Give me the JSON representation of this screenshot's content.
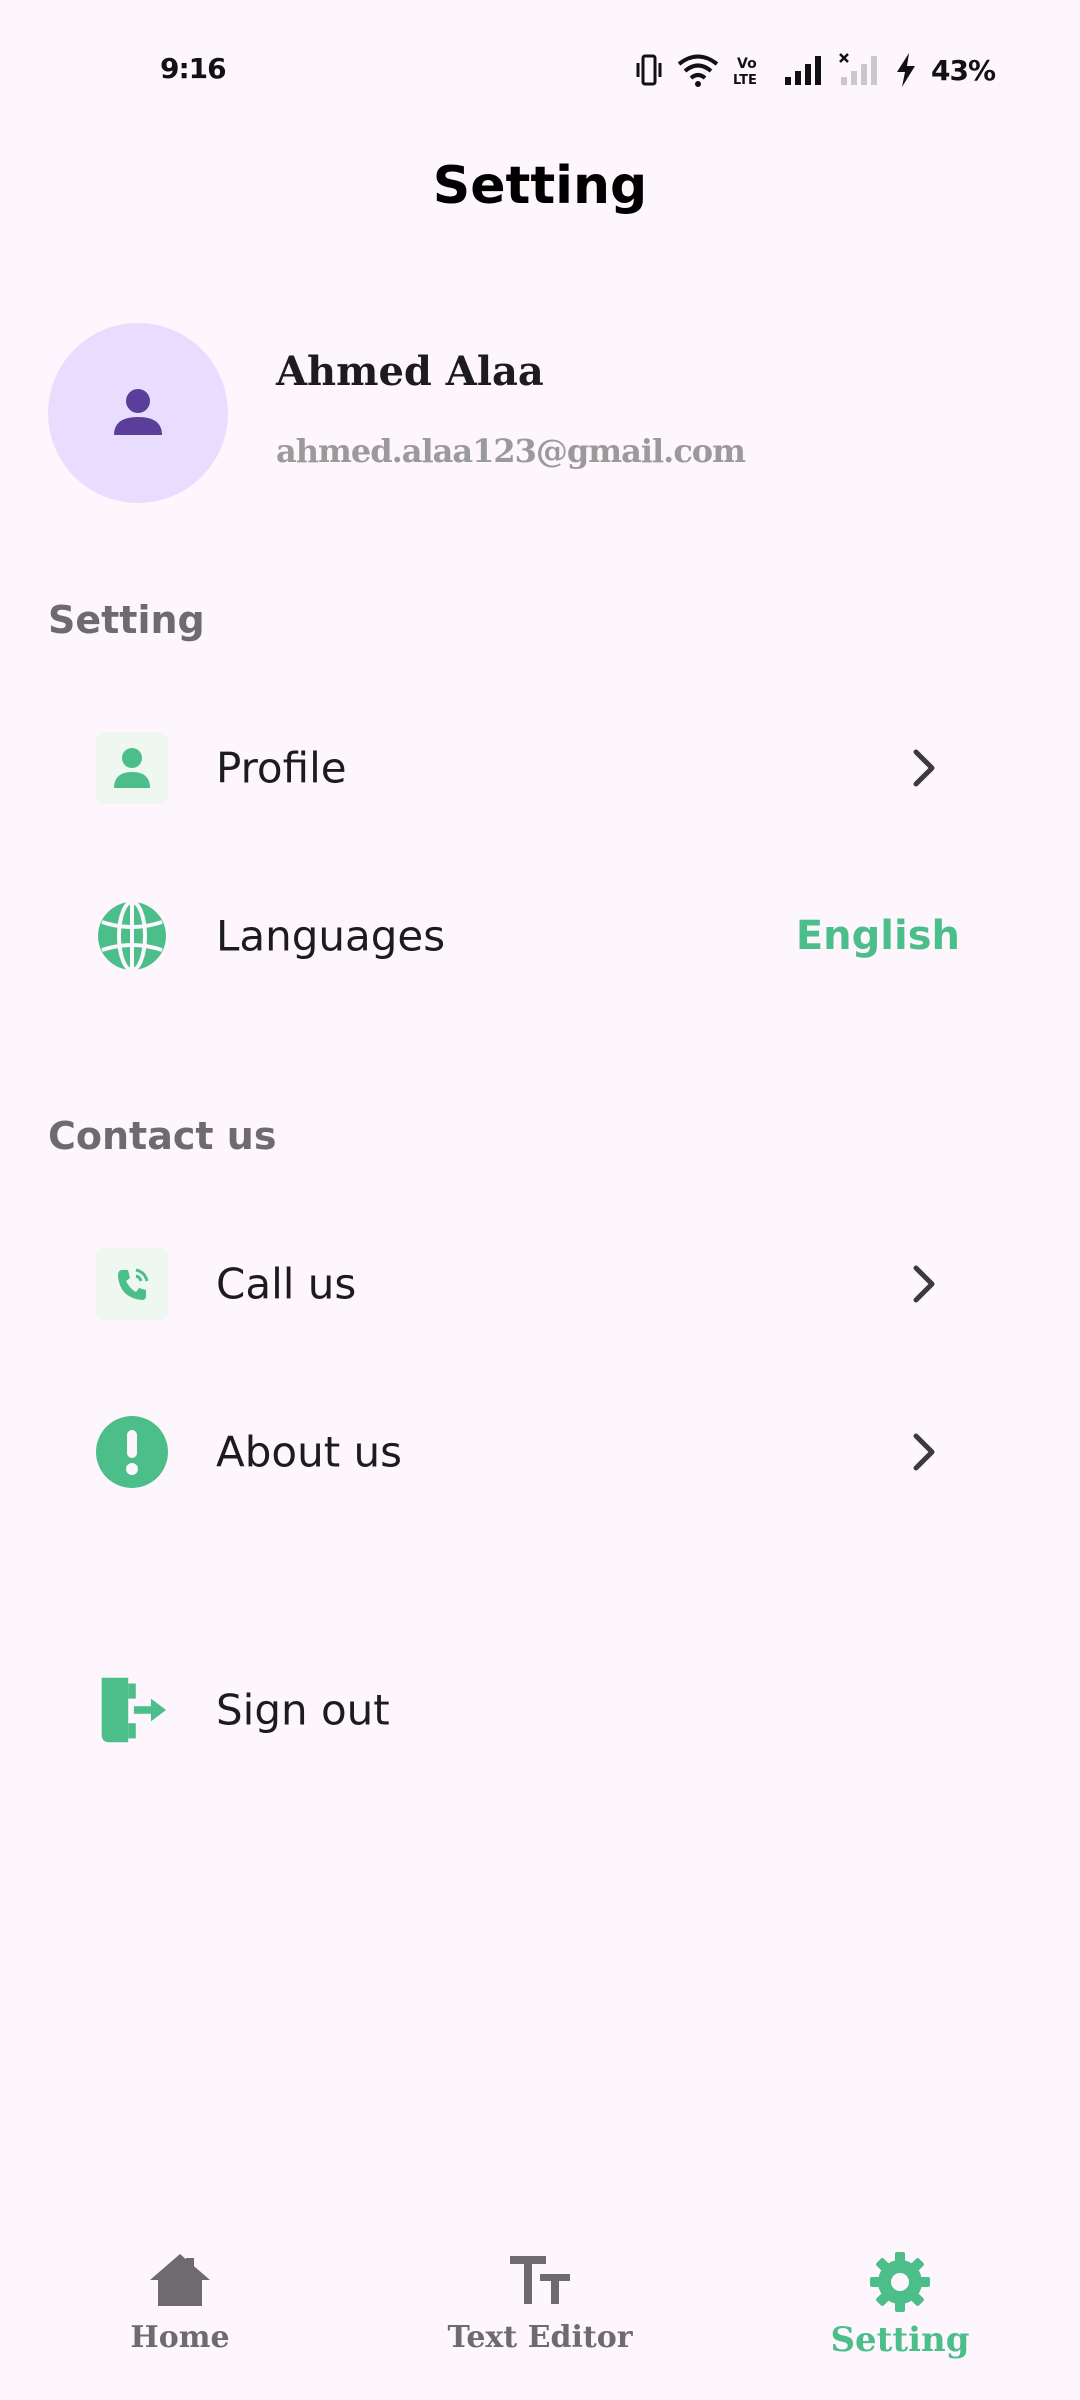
{
  "status_bar": {
    "time": "9:16",
    "battery": "43%",
    "icons": [
      "vibrate-icon",
      "wifi-icon",
      "volte-icon",
      "signal-icon",
      "signal-no-sim-icon",
      "charging-icon"
    ]
  },
  "header": {
    "title": "Setting"
  },
  "profile": {
    "name": "Ahmed Alaa",
    "email": "ahmed.alaa123@gmail.com",
    "avatar_icon": "person-icon"
  },
  "sections": {
    "setting_title": "Setting",
    "contact_title": "Contact us"
  },
  "rows": {
    "profile": {
      "label": "Profile",
      "icon": "person-icon"
    },
    "languages": {
      "label": "Languages",
      "value": "English",
      "icon": "globe-icon"
    },
    "call_us": {
      "label": "Call us",
      "icon": "phone-icon"
    },
    "about_us": {
      "label": "About us",
      "icon": "info-icon"
    },
    "sign_out": {
      "label": "Sign out",
      "icon": "logout-icon"
    }
  },
  "bottom_nav": {
    "items": [
      {
        "label": "Home",
        "icon": "home-icon",
        "active": false
      },
      {
        "label": "Text Editor",
        "icon": "text-size-icon",
        "active": false
      },
      {
        "label": "Setting",
        "icon": "gear-icon",
        "active": true
      }
    ]
  },
  "colors": {
    "accent": "#4cbe8a",
    "background": "#fdf6fd",
    "avatar_bg": "#e8ddff",
    "avatar_icon": "#5a3e9a",
    "muted_text": "#6d6a70"
  }
}
